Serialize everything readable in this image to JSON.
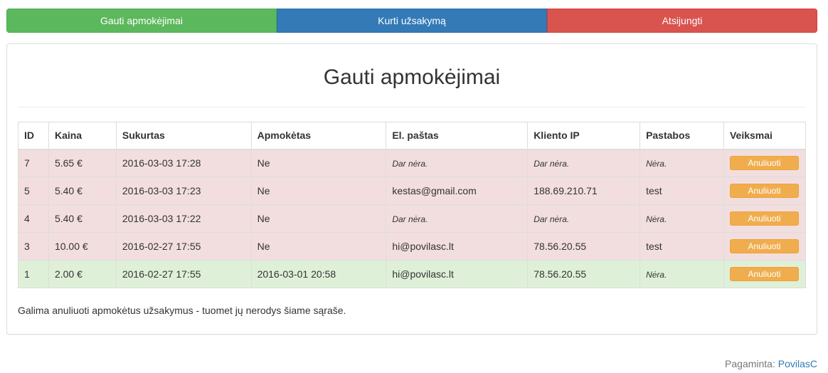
{
  "nav": {
    "received_label": "Gauti apmokėjimai",
    "create_label": "Kurti užsakymą",
    "logout_label": "Atsijungti"
  },
  "colors": {
    "nav_green": "#5cb85c",
    "nav_blue": "#337ab7",
    "nav_red": "#d9534f",
    "row_danger": "#f2dede",
    "row_success": "#dff0d8",
    "cancel_button": "#f0ad4e",
    "link": "#337ab7"
  },
  "main": {
    "title": "Gauti apmokėjimai",
    "note": "Galima anuliuoti apmokėtus užsakymus - tuomet jų nerodys šiame sąraše."
  },
  "table": {
    "headers": [
      "ID",
      "Kaina",
      "Sukurtas",
      "Apmokėtas",
      "El. paštas",
      "Kliento IP",
      "Pastabos",
      "Veiksmai"
    ],
    "rows": [
      {
        "id": "7",
        "price": "5.65 €",
        "created": "2016-03-03 17:28",
        "paid": "Ne",
        "email": "Dar nėra.",
        "ip": "Dar nėra.",
        "notes": "Nėra.",
        "action": "Anuliuoti",
        "status": "danger"
      },
      {
        "id": "5",
        "price": "5.40 €",
        "created": "2016-03-03 17:23",
        "paid": "Ne",
        "email": "kestas@gmail.com",
        "ip": "188.69.210.71",
        "notes": "test",
        "action": "Anuliuoti",
        "status": "danger"
      },
      {
        "id": "4",
        "price": "5.40 €",
        "created": "2016-03-03 17:22",
        "paid": "Ne",
        "email": "Dar nėra.",
        "ip": "Dar nėra.",
        "notes": "Nėra.",
        "action": "Anuliuoti",
        "status": "danger"
      },
      {
        "id": "3",
        "price": "10.00 €",
        "created": "2016-02-27 17:55",
        "paid": "Ne",
        "email": "hi@povilasc.lt",
        "ip": "78.56.20.55",
        "notes": "test",
        "action": "Anuliuoti",
        "status": "danger"
      },
      {
        "id": "1",
        "price": "2.00 €",
        "created": "2016-02-27 17:55",
        "paid": "2016-03-01 20:58",
        "email": "hi@povilasc.lt",
        "ip": "78.56.20.55",
        "notes": "Nėra.",
        "action": "Anuliuoti",
        "status": "success"
      }
    ]
  },
  "footer": {
    "prefix": "Pagaminta:",
    "author": "PovilasC"
  }
}
